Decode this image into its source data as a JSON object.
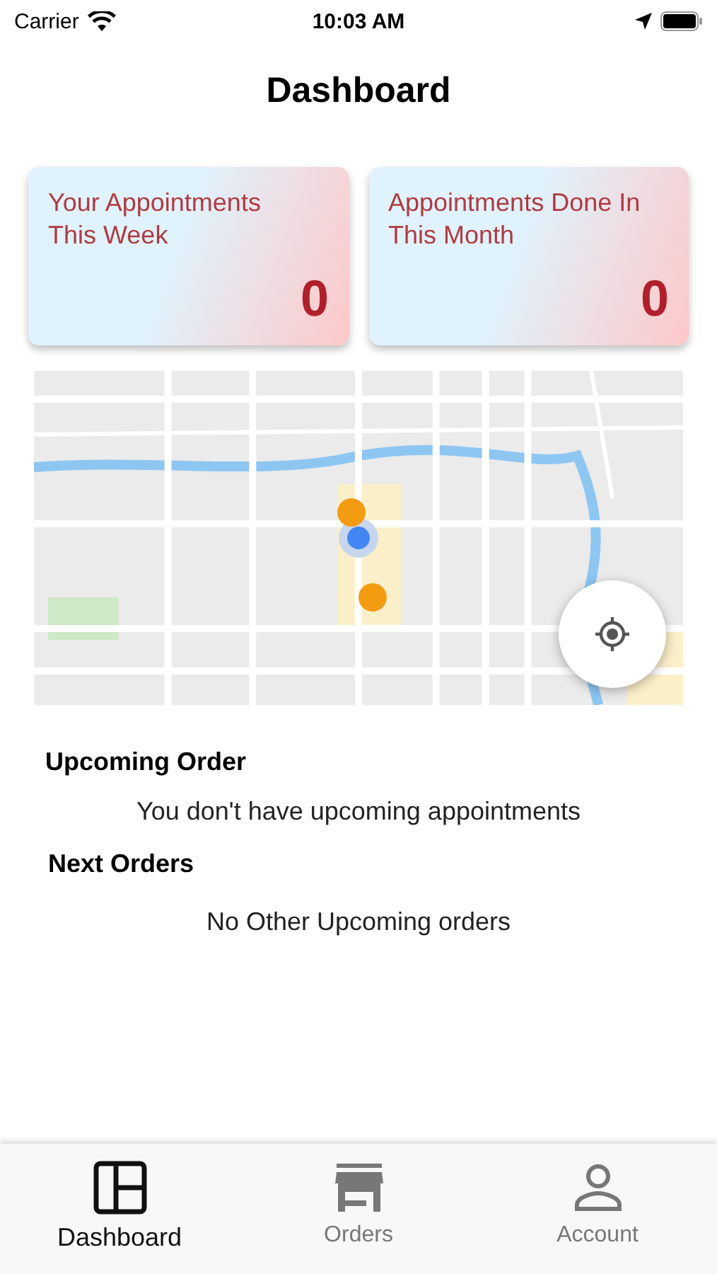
{
  "status_bar": {
    "carrier": "Carrier",
    "time": "10:03 AM"
  },
  "title": "Dashboard",
  "stat_cards": [
    {
      "label": "Your Appointments This Week",
      "value": "0"
    },
    {
      "label": "Appointments Done In This Month",
      "value": "0"
    }
  ],
  "upcoming": {
    "heading": "Upcoming Order",
    "message": "You don't have upcoming appointments"
  },
  "next_orders": {
    "heading": "Next Orders",
    "message": "No Other Upcoming orders"
  },
  "tabs": [
    {
      "label": "Dashboard",
      "kind": "dashboard",
      "selected": true
    },
    {
      "label": "Orders",
      "kind": "store",
      "selected": false
    },
    {
      "label": "Account",
      "kind": "person",
      "selected": false
    }
  ]
}
